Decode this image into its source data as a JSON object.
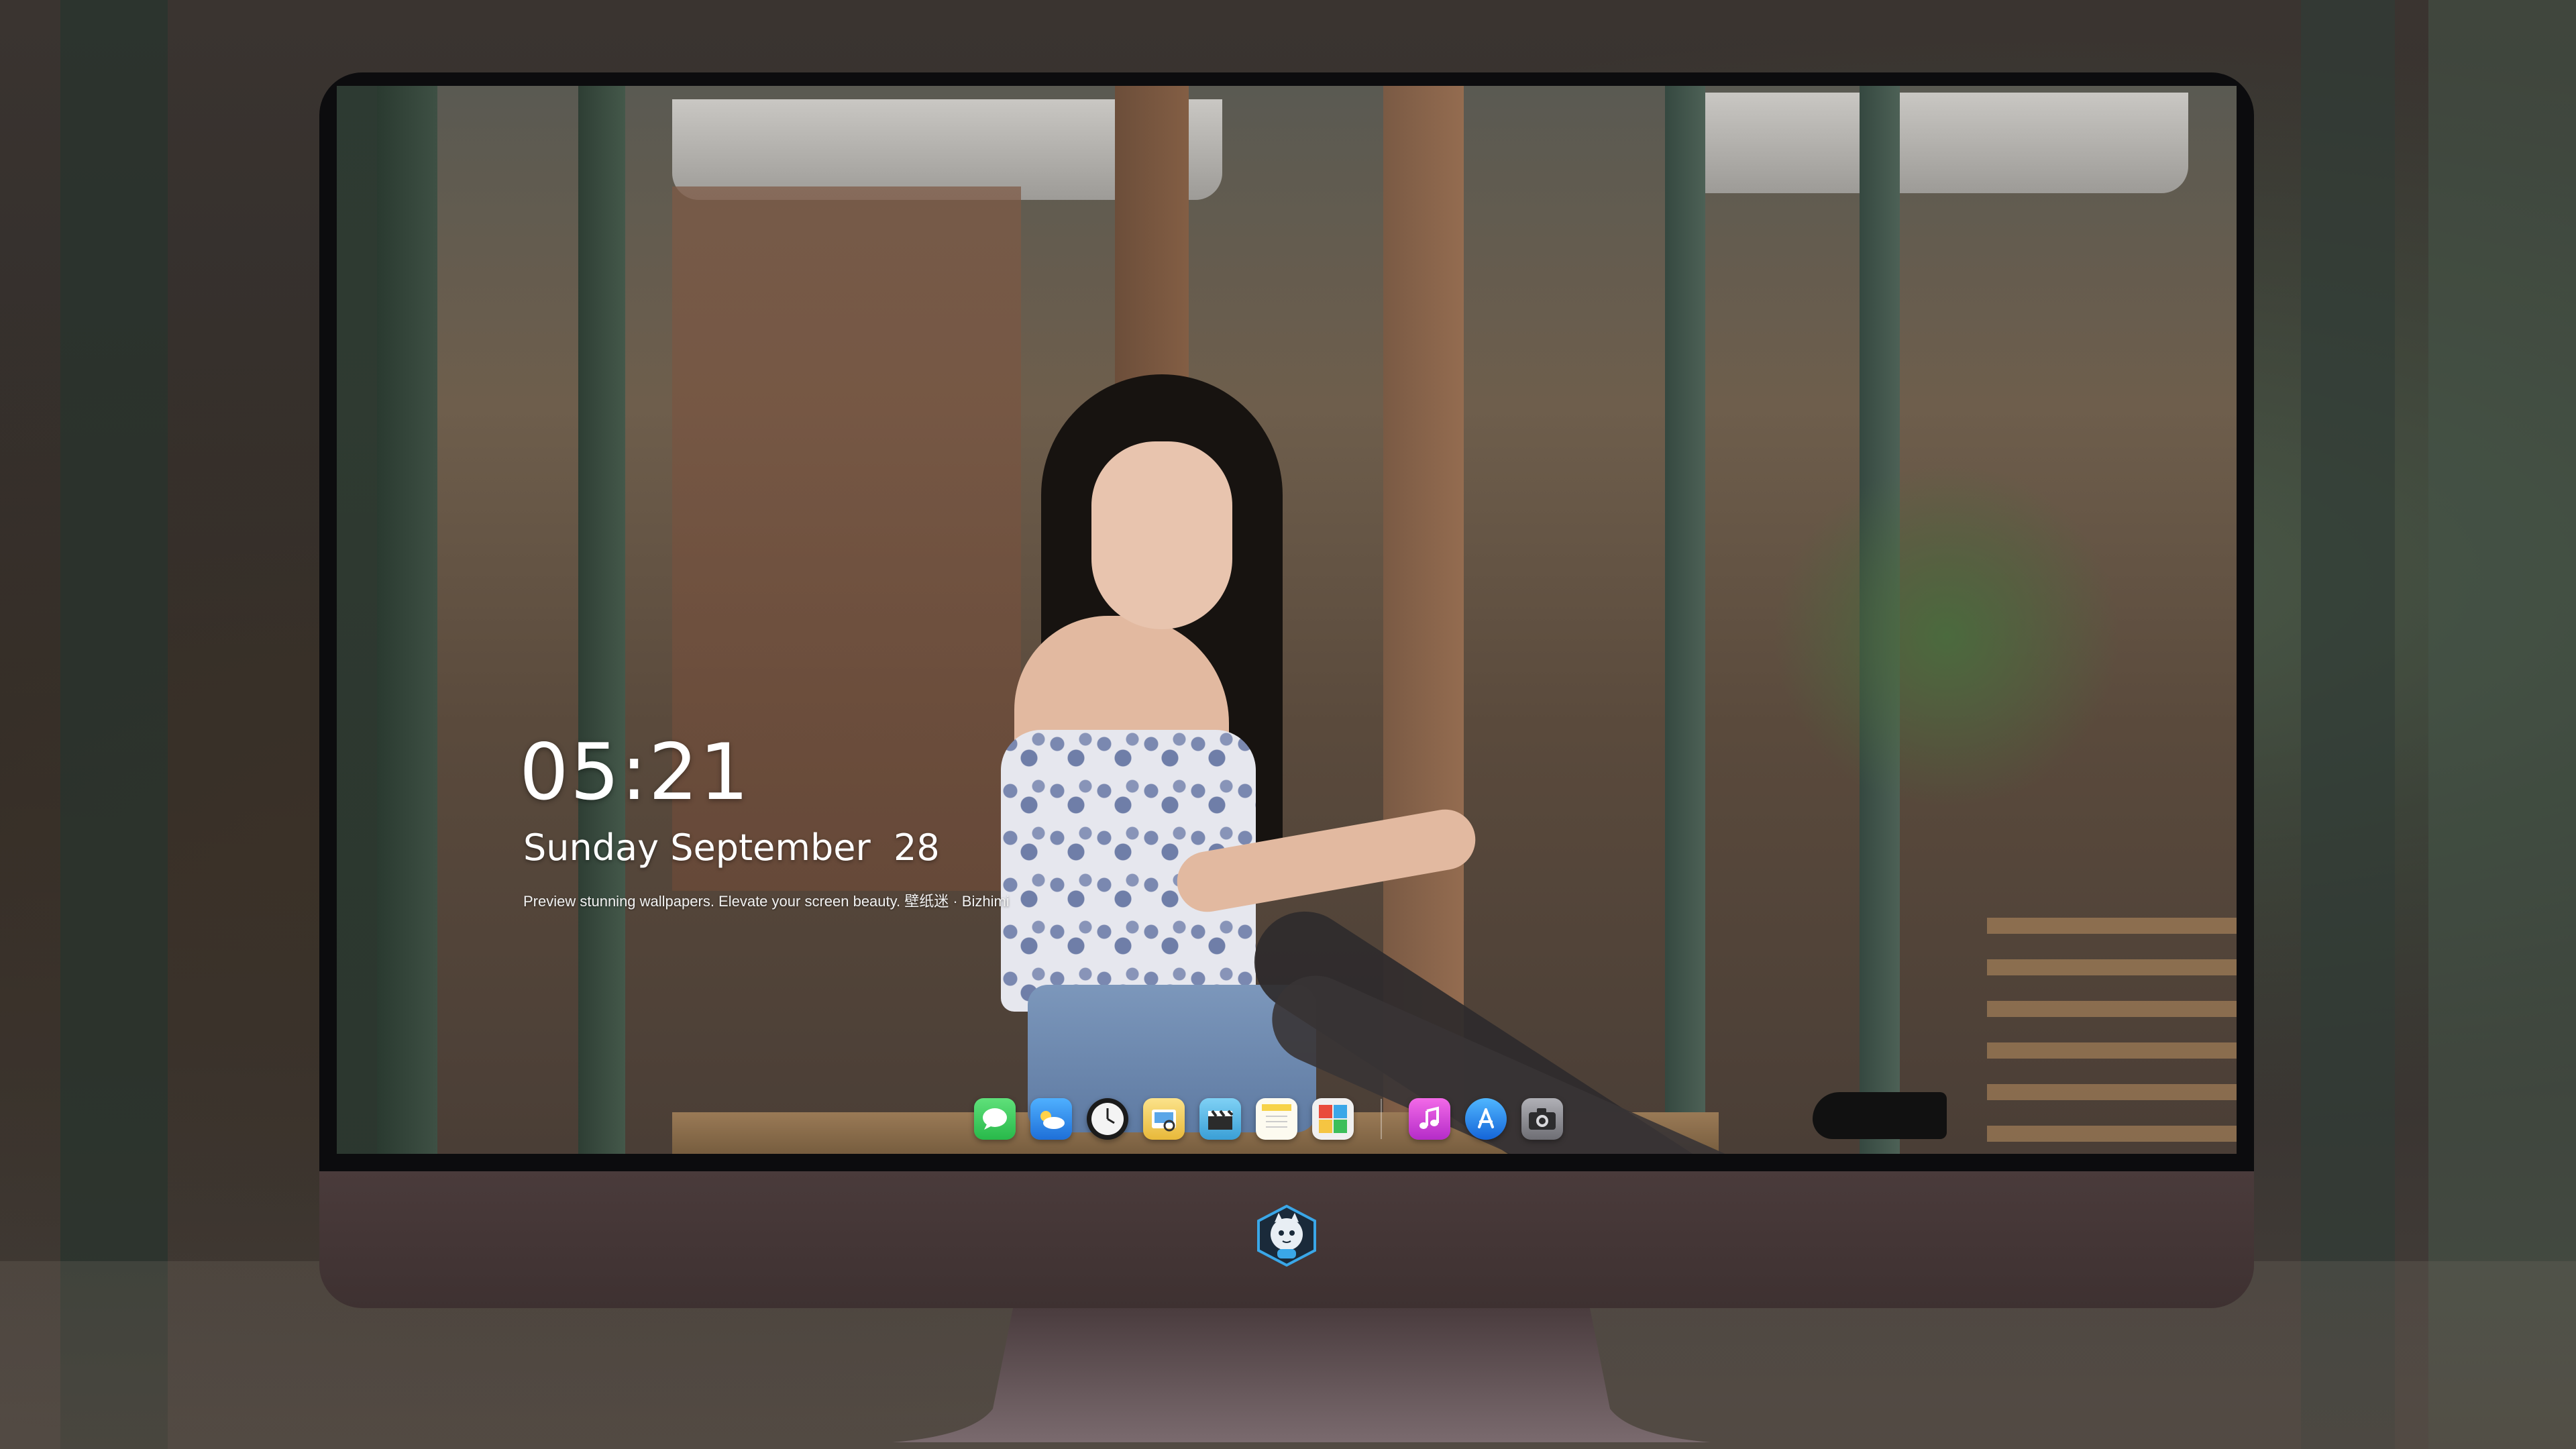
{
  "lock_screen": {
    "time": "05:21",
    "date": "Sunday September  28",
    "tagline": "Preview stunning wallpapers. Elevate your screen beauty. 壁纸迷 · Bizhimi"
  },
  "dock": {
    "apps": [
      {
        "name": "messages-icon",
        "color": "#34c759"
      },
      {
        "name": "weather-icon",
        "color": "#2f8cf0"
      },
      {
        "name": "clock-icon",
        "color": "#f2f2f2"
      },
      {
        "name": "preview-icon",
        "color": "#f5c542"
      },
      {
        "name": "claquette-icon",
        "color": "#55b5e6"
      },
      {
        "name": "notes-icon",
        "color": "#f7d34a"
      },
      {
        "name": "photo-booth-icon",
        "color": "#e8e8e8"
      },
      {
        "name": "itunes-icon",
        "color": "#d63fd0"
      },
      {
        "name": "app-store-icon",
        "color": "#1c8ef9"
      },
      {
        "name": "camera-icon",
        "color": "#8e8e93"
      }
    ]
  },
  "brand": {
    "logo": "mascot-logo",
    "accent": "#3aa7e8"
  }
}
